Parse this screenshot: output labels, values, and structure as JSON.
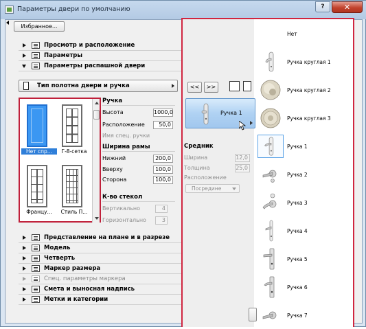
{
  "window": {
    "title": "Параметры двери по умолчанию",
    "help_label": "?",
    "close_label": "✕"
  },
  "toolbar": {
    "favorites_label": "Избранное..."
  },
  "sections_top": [
    {
      "label": "Просмотр и расположение",
      "expanded": false
    },
    {
      "label": "Параметры",
      "expanded": false
    },
    {
      "label": "Параметры распашной двери",
      "expanded": true
    }
  ],
  "type_selector": {
    "label": "Тип полотна двери и ручка"
  },
  "gallery": {
    "items": [
      {
        "label": "Нет спр...",
        "selected": true
      },
      {
        "label": "Г-8-сетка",
        "selected": false
      },
      {
        "label": "Францу...",
        "selected": false
      },
      {
        "label": "Стиль П...",
        "selected": false
      }
    ]
  },
  "handle_panel": {
    "heading": "Ручка",
    "height_label": "Высота",
    "height_value": "1000,0",
    "position_label": "Расположение",
    "position_value": "50,0",
    "special_name_label": "Имя спец. ручки"
  },
  "frame_panel": {
    "heading": "Ширина рамы",
    "bottom_label": "Нижний",
    "bottom_value": "200,0",
    "top_label": "Вверху",
    "top_value": "100,0",
    "side_label": "Сторона",
    "side_value": "100,0"
  },
  "glass_panel": {
    "heading": "К-во стекол",
    "vertical_label": "Вертикально",
    "vertical_value": "4",
    "horizontal_label": "Горизонтально",
    "horizontal_value": "3"
  },
  "nav": {
    "prev_label": "<<",
    "next_label": ">>"
  },
  "handle_selector": {
    "label": "Ручка 1"
  },
  "mullion_panel": {
    "heading": "Средник",
    "width_label": "Ширина",
    "width_value": "12,0",
    "thickness_label": "Толщина",
    "thickness_value": "25,0",
    "position_label": "Расположение",
    "position_value": "Посредине"
  },
  "sections_bottom": [
    {
      "label": "Представление на плане и в разрезе",
      "disabled": false
    },
    {
      "label": "Модель",
      "disabled": false
    },
    {
      "label": "Четверть",
      "disabled": false
    },
    {
      "label": "Маркер размера",
      "disabled": false
    },
    {
      "label": "Спец. параметры маркера",
      "disabled": true
    },
    {
      "label": "Смета и выносная надпись",
      "disabled": false
    },
    {
      "label": "Метки и категории",
      "disabled": false
    }
  ],
  "handle_list": {
    "items": [
      {
        "label": "Нет",
        "icon": "none",
        "selected": false
      },
      {
        "label": "Ручка круглая 1",
        "icon": "handle-lever-plate-icon",
        "selected": false
      },
      {
        "label": "Ручка круглая 2",
        "icon": "knob-icon",
        "selected": false
      },
      {
        "label": "Ручка круглая 3",
        "icon": "knob-icon",
        "selected": false
      },
      {
        "label": "Ручка 1",
        "icon": "handle-lever-plate-icon",
        "selected": true
      },
      {
        "label": "Ручка 2",
        "icon": "lever-rosette-icon",
        "selected": false
      },
      {
        "label": "Ручка 3",
        "icon": "lever-rosette-icon",
        "selected": false
      },
      {
        "label": "Ручка 4",
        "icon": "handle-lever-plate-icon",
        "selected": false
      },
      {
        "label": "Ручка 5",
        "icon": "handle-lever-plate-icon",
        "selected": false
      },
      {
        "label": "Ручка 6",
        "icon": "handle-lever-plate-icon",
        "selected": false
      },
      {
        "label": "Ручка 7",
        "icon": "lever-rosette-icon",
        "selected": false
      }
    ]
  },
  "colors": {
    "highlight_border": "#d0253f",
    "selection_blue": "#2f7fd9",
    "panel_bg": "#f0f0f0",
    "title_bg": "#c6d9ee"
  }
}
